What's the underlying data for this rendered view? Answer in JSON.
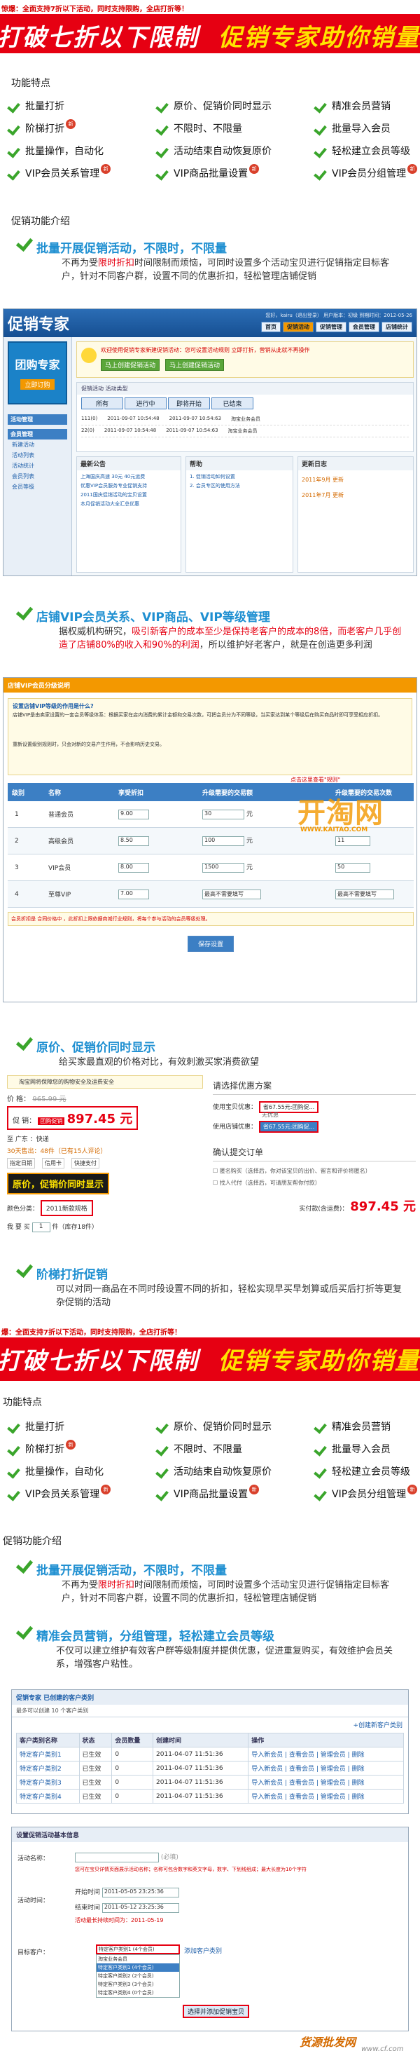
{
  "top_notice": "惊爆：全面支持7折以下活动，同时支持限购，全店打折等！",
  "top_notice2": "爆：全面支持7折以下活动，同时支持限购，全店打折等！",
  "banner": {
    "left": "打破七折以下限制",
    "right": "促销专家助你销量大增"
  },
  "features_title": "功能特点",
  "features": [
    {
      "label": "批量打折",
      "new": false
    },
    {
      "label": "原价、促销价同时显示",
      "new": false
    },
    {
      "label": "精准会员营销",
      "new": false
    },
    {
      "label": "阶梯打折",
      "new": true
    },
    {
      "label": "不限时、不限量",
      "new": false
    },
    {
      "label": "批量导入会员",
      "new": false
    },
    {
      "label": "批量操作，自动化",
      "new": false
    },
    {
      "label": "活动结束自动恢复原价",
      "new": false
    },
    {
      "label": "轻松建立会员等级",
      "new": false
    },
    {
      "label": "VIP会员关系管理",
      "new": true
    },
    {
      "label": "VIP商品批量设置",
      "new": true
    },
    {
      "label": "VIP会员分组管理",
      "new": true
    }
  ],
  "intro_title": "促销功能介绍",
  "intro1": {
    "heading": "批量开展促销活动，不限时，不限量",
    "text_a": "不再为受",
    "text_red": "限时折扣",
    "text_b": "时间限制而烦恼，可同时设置多个活动宝贝进行促销指定目标客户，针对不同客户群，设置不同的优惠折扣，轻松管理店铺促销"
  },
  "app1": {
    "logo": "促销专家",
    "header_right": "您好，kairu（退出登录） 用户版本：初级 到期时间：2012-05-26",
    "tabs": [
      "首页",
      "促销活动",
      "促销管理",
      "会员管理",
      "店铺统计"
    ],
    "sidebar_ad": "团购专家",
    "sidebar_ad_sub": "立即订购",
    "sidebar_sections": [
      "活动管理",
      "会员管理"
    ],
    "sidebar_items": [
      "新建活动",
      "活动列表",
      "活动统计",
      "会员列表",
      "会员等级"
    ],
    "alert": "欢迎使用促销专家新建促销活动：您可设置活动规则 立即打折，营销从此就不再操作",
    "alert_buttons": [
      "马上创建促销活动",
      "马上创建促销活动"
    ],
    "activity_label": "促销活动  活动类型",
    "table_headers": [
      "所有",
      "进行中",
      "即将开始",
      "已结束"
    ],
    "rows": [
      {
        "name": "111(0)",
        "start": "2011-09-07 10:54:48",
        "end": "2011-09-07 10:54:63",
        "shop": "淘宝业务会员"
      },
      {
        "name": "22(0)",
        "start": "2011-09-07 10:54:48",
        "end": "2011-09-07 10:54:63",
        "shop": "淘宝业务会员"
      }
    ],
    "news_title": "最新公告",
    "news": [
      "上海国庆高速 30元 40元运费",
      "优惠VIP会员服务专业促销支持",
      "2011国庆促销活动的宝贝设置",
      "本月促销活动大全汇总优惠"
    ],
    "help_title": "帮助",
    "help": [
      "1. 促销活动如何设置",
      "2. 会员专区的使用方法"
    ],
    "updates_title": "更新日志",
    "updates": [
      "2011年9月 更新",
      "2011年7月 更新"
    ]
  },
  "intro2": {
    "heading": "店铺VIP会员关系、VIP商品、VIP等级管理",
    "text_a": "据权威机构研究，",
    "text_red": "吸引新客户的成本至少是保持老客户的成本的8倍，而老客户几乎创造了店铺80%的收入和90%的利润",
    "text_b": "，所以维护好老客户，就是在创造更多利润"
  },
  "app2": {
    "title": "店铺VIP会员分级说明",
    "sub": "设置店铺VIP等级的作用是什么?",
    "para": "店铺VIP是由卖家设置的一套会员等级体系：根据买家在店内消费的累计金额和交易次数，可把会员分为不同等级，当买家达到某个等级后在购买商品时即可享受相应折扣。",
    "para2": "重新设置级别规则时，只会对新的交易产生作用，不会影响历史交易。",
    "headers": [
      "级别",
      "名称",
      "享受折扣",
      "升级需要的交易额",
      "升级需要的交易次数"
    ],
    "note": "点击这里查看\"规则\"",
    "levels": [
      {
        "id": "1",
        "name": "普通会员",
        "discount": "9.00",
        "amount": "30",
        "count": ""
      },
      {
        "id": "2",
        "name": "高级会员",
        "discount": "8.50",
        "amount": "100",
        "count": "11"
      },
      {
        "id": "3",
        "name": "VIP会员",
        "discount": "8.00",
        "amount": "1500",
        "count": "50"
      },
      {
        "id": "4",
        "name": "至尊VIP",
        "discount": "7.00",
        "amount": "最高不需要填写",
        "count": "最高不需要填写"
      }
    ],
    "unit": "元",
    "hint": "会员折扣是 合同价格中 ，此折扣上限依据商城行业规则，将每个参与活动的会员等级处理。",
    "save": "保存设置",
    "watermark": "开淘网",
    "watermark_url": "WWW.KAITAO.COM"
  },
  "intro3": {
    "heading": "原价、促销价同时显示",
    "text": "给买家最直观的价格对比，有效刺激买家消费欲望"
  },
  "price_demo": {
    "notice": "淘宝网将保障您的购物安全及运费安全",
    "price_label": "价   格：",
    "orig_price": "965.99 元",
    "promo_label": "促   销：",
    "promo_tag": "团购促销",
    "promo_price": "897.45 元",
    "area_label": "至 广东 ：快递",
    "sold": "30天售出：48件（已有15人评论）",
    "tags": [
      "指定日期",
      "信用卡",
      "快捷支付"
    ],
    "callout": "原价，促销价同时显示",
    "color_label": "颜色分类：",
    "color_value": "2011新款规格",
    "qty_label": "我 要 买",
    "qty_value": "1",
    "qty_unit": "件（库存18件）",
    "plan_title": "请选择优惠方案",
    "plan1_label": "使用宝贝优惠：",
    "plan1_value": "省67.55元:团购促...",
    "plan1_opt": "无优惠",
    "plan2_label": "使用店铺优惠：",
    "plan2_value": "省67.55元:团购促...",
    "confirm_title": "确认提交订单",
    "confirm1": "匿名购买（选择后，你对该宝贝的出价、留言和评价将匿名）",
    "confirm2": "找人代付（选择后，可请朋友帮你付款）",
    "total_label": "实付款(含运费)：",
    "total": "897.45 元"
  },
  "intro4": {
    "heading": "阶梯打折促销",
    "text": "可以对同一商品在不同时段设置不同的折扣，轻松实现早买早划算或后买后打折等更复杂促销的活动"
  },
  "intro5": {
    "heading": "批量开展促销活动，不限时，不限量",
    "text_a": "不再为受",
    "text_red": "限时折扣",
    "text_b": "时间限制而烦恼，可同时设置多个活动宝贝进行促销指定目标客户，针对不同客户群，设置不同的优惠折扣，轻松管理店铺促销"
  },
  "intro6": {
    "heading": "精准会员营销，分组管理，轻松建立会员等级",
    "text": "不仅可以建立维护有效客户群等级制度并提供优惠，促进重复购买，有效维护会员关系，增强客户粘性。"
  },
  "app3": {
    "title": "促销专家  已创建的客户类别",
    "sub": "最多可以创建 10 个客户类别",
    "create": "+创建新客户类别",
    "headers": [
      "客户类别名称",
      "状态",
      "会员数量",
      "创建时间",
      "操作"
    ],
    "rows": [
      {
        "name": "特定客户类别1",
        "status": "已生效",
        "count": "0",
        "time": "2011-04-07 11:51:36",
        "op": "导入新会员 | 查看会员 | 管理会员 | 删除"
      },
      {
        "name": "特定客户类别2",
        "status": "已生效",
        "count": "0",
        "time": "2011-04-07 11:51:36",
        "op": "导入新会员 | 查看会员 | 管理会员 | 删除"
      },
      {
        "name": "特定客户类别3",
        "status": "已生效",
        "count": "0",
        "time": "2011-04-07 11:51:36",
        "op": "导入新会员 | 查看会员 | 管理会员 | 删除"
      },
      {
        "name": "特定客户类别4",
        "status": "已生效",
        "count": "0",
        "time": "2011-04-07 11:51:36",
        "op": "导入新会员 | 查看会员 | 管理会员 | 删除"
      }
    ]
  },
  "app4": {
    "title": "设置促销活动基本信息",
    "name_label": "活动名称：",
    "name_note": "(必填)",
    "name_hint": "您可在宝贝详情页面展示活动名称；名称可包含数字和英文字母，数字、下划线组成；最大长度为10个字符",
    "time_label": "活动时间：",
    "start_label": "开始时间",
    "start": "2011-05-05 23:25:36",
    "end_label": "结束时间",
    "end": "2011-05-12 23:25:36",
    "time_hint": "活动最长持续时间为：2011-05-19",
    "target_label": "目标客户：",
    "target_value": "特定客户类别1 (4个会员)",
    "target_add": "添加客户类别",
    "target_opts": [
      "淘宝业务会员",
      "特定客户类别1 (4个会员)",
      "特定客户类别2 (2个会员)",
      "特定客户类别3 (3个会员)",
      "特定客户类别4 (0个会员)"
    ],
    "next": "选择并添加促销宝贝",
    "footer_brand": "货源批发网",
    "footer_url": "www.cf.com"
  }
}
